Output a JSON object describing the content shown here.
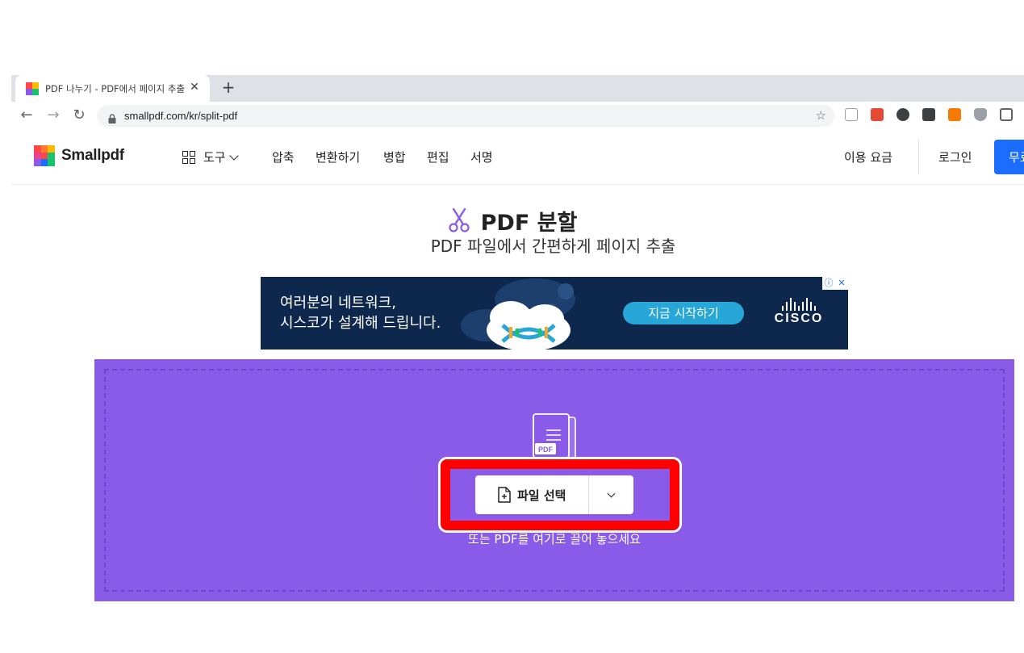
{
  "browser": {
    "tab_title": "PDF 나누기 - PDF에서 페이지 추출",
    "tab_close": "✕",
    "new_tab": "+",
    "url": "smallpdf.com/kr/split-pdf",
    "back": "←",
    "forward": "→",
    "reload": "↻",
    "bookmark_star": "☆"
  },
  "site": {
    "brand": "Smallpdf",
    "nav": {
      "tools": "도구",
      "items": [
        "압축",
        "변환하기",
        "병합",
        "편집",
        "서명"
      ]
    },
    "pricing": "이용 요금",
    "login": "로그인",
    "signup": "무료"
  },
  "hero": {
    "title": "PDF 분할",
    "subtitle": "PDF 파일에서 간편하게 페이지 추출"
  },
  "ad": {
    "line1": "여러분의 네트워크,",
    "line2": "시스코가 설계해 드립니다.",
    "cta": "지금 시작하기",
    "brand": "CISCO",
    "info_icon": "ⓘ",
    "close_icon": "✕"
  },
  "upload": {
    "choose_label": "파일 선택",
    "file_badge": "PDF",
    "drop_hint": "또는 PDF를 여기로 끌어 놓으세요"
  },
  "colors": {
    "accent": "#8a5be8",
    "primary_button": "#1a6dff",
    "highlight": "#ff0000"
  }
}
